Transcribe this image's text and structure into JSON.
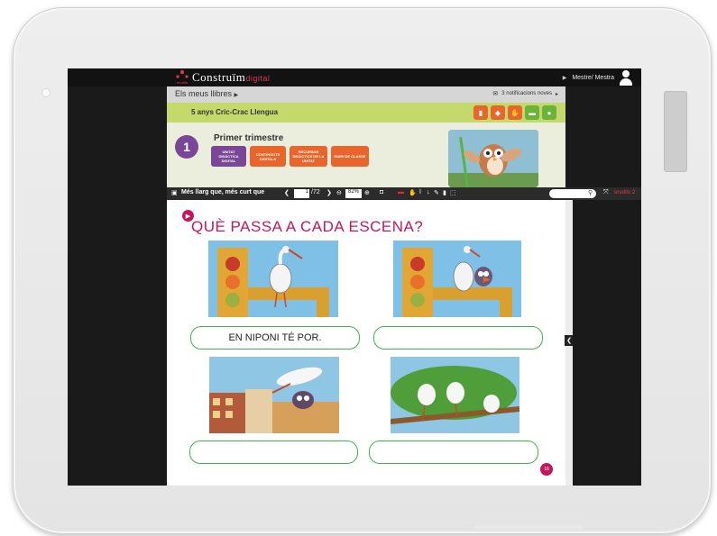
{
  "app": {
    "logo_small": "erudita",
    "logo_main": "Construïm",
    "logo_suffix": "digital"
  },
  "user": {
    "name": "Mestre/ Mestra"
  },
  "breadcrumb": {
    "label": "Els meus llibres",
    "notifications": "3 notificacions noves"
  },
  "book": {
    "title": "5 anys Cric-Crac Llengua",
    "tools": [
      {
        "icon": "book-icon",
        "color": "#e8662c"
      },
      {
        "icon": "graduation-cap-icon",
        "color": "#e8662c"
      },
      {
        "icon": "handshake-icon",
        "color": "#e8662c"
      },
      {
        "icon": "window-icon",
        "color": "#6ab43a"
      },
      {
        "icon": "user-icon",
        "color": "#6ab43a"
      }
    ]
  },
  "unit": {
    "number": "1",
    "name": "Primer trimestre",
    "buttons": [
      {
        "label": "UNITAT DIDÀCTICA DIGITAL",
        "color": "#7a4696"
      },
      {
        "label": "CONTINGUTS DIGITALS",
        "color": "#e8662c"
      },
      {
        "label": "RECURSOS DIDÀCTICS DE LA UNITAT",
        "color": "#e8662c"
      },
      {
        "label": "DIARI DE CLASSE",
        "color": "#e8662c"
      }
    ]
  },
  "reader": {
    "chapter": "Més llarg que, més curt que",
    "page_current": "1",
    "page_total": "/72",
    "zoom": "82%",
    "extra": "erudito 2"
  },
  "page": {
    "heading": "QUÈ PASSA A CADA ESCENA?",
    "answers": [
      "EN NIPONI TÉ POR.",
      "",
      "",
      ""
    ],
    "page_number": "16"
  },
  "colors": {
    "accent": "#c2185b",
    "green_border": "#3cb44a",
    "header_green": "#c5d86b",
    "purple": "#7a4696",
    "orange": "#e8662c"
  }
}
